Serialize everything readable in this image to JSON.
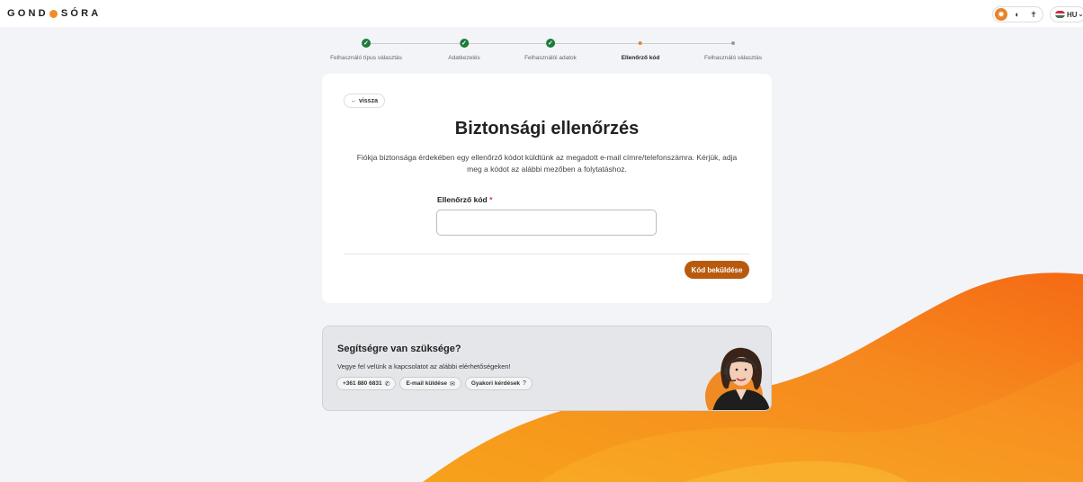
{
  "header": {
    "logo_left": "GOND",
    "logo_right": "SÓRA",
    "theme_icons": [
      "sun-icon",
      "moon-icon",
      "cross-icon"
    ],
    "language": "HU"
  },
  "stepper": {
    "steps": [
      {
        "label": "Felhasználó típus választás",
        "status": "done"
      },
      {
        "label": "Adatkezelés",
        "status": "done"
      },
      {
        "label": "Felhasználói adatok",
        "status": "done"
      },
      {
        "label": "Ellenőrző kód",
        "status": "current"
      },
      {
        "label": "Felhasználó választás",
        "status": "pending"
      }
    ]
  },
  "card": {
    "back_label": "← vissza",
    "title": "Biztonsági ellenőrzés",
    "description": "Fiókja biztonsága érdekében egy ellenőrző kódot küldtünk az megadott e-mail címre/telefonszámra. Kérjük, adja meg a kódot az alábbi mezőben a folytatáshoz.",
    "field_label": "Ellenőrző kód",
    "required_mark": "*",
    "input_value": "",
    "submit_label": "Kód beküldése"
  },
  "help": {
    "title": "Segítségre van szüksége?",
    "subtitle": "Vegye fel velünk a kapcsolatot az alábbi elérhetőségeken!",
    "phone": "+361 880 6831",
    "email": "E-mail küldése",
    "faq": "Gyakori kérdések"
  },
  "colors": {
    "accent": "#e8832a",
    "button": "#b85a0e",
    "done": "#1e7b3a"
  }
}
